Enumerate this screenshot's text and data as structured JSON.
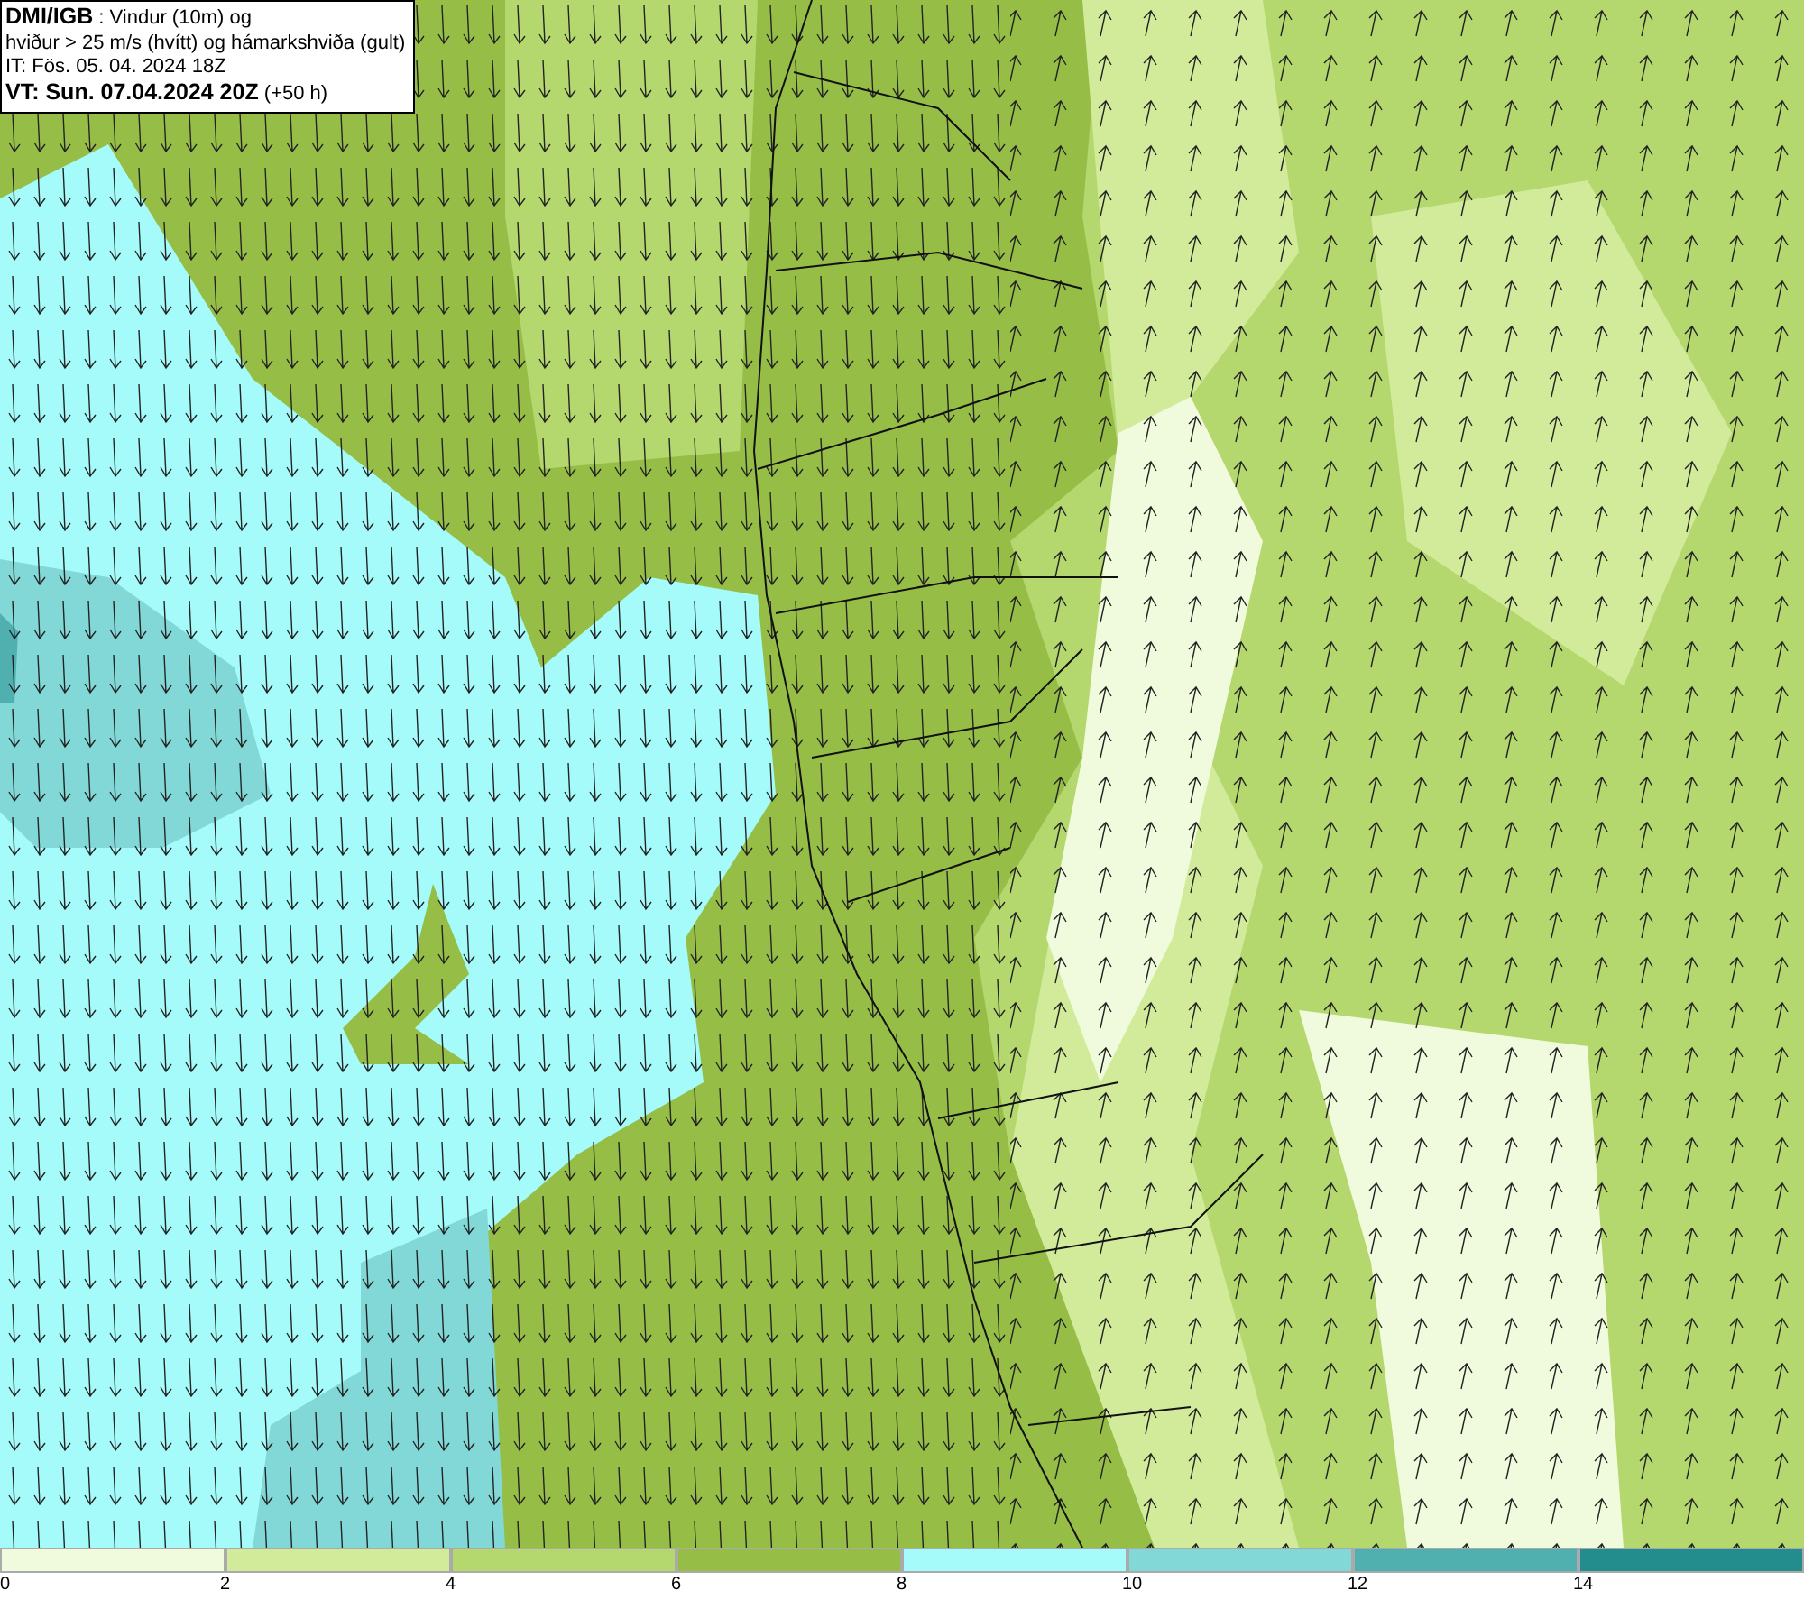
{
  "title_box": {
    "lines": [
      "**DMI/IGB** : Vindur (10m) og",
      "hviður > 25 m/s (hvítt) og hámarkshviða (gult)",
      "IT: Fös. 05. 04. 2024 18Z",
      "**VT: Sun. 07.04.2024 20Z** (+50 h)"
    ]
  },
  "legend": [
    {
      "color": "#f0fadc",
      "label": "0"
    },
    {
      "color": "#d2eb9b",
      "label": "2"
    },
    {
      "color": "#b4d76e",
      "label": "4"
    },
    {
      "color": "#96be46",
      "label": "6"
    },
    {
      "color": "#a5fafa",
      "label": "8"
    },
    {
      "color": "#82d7d7",
      "label": "10"
    },
    {
      "color": "#50afaf",
      "label": "12"
    },
    {
      "color": "#238c8c",
      "label": "14"
    }
  ]
}
